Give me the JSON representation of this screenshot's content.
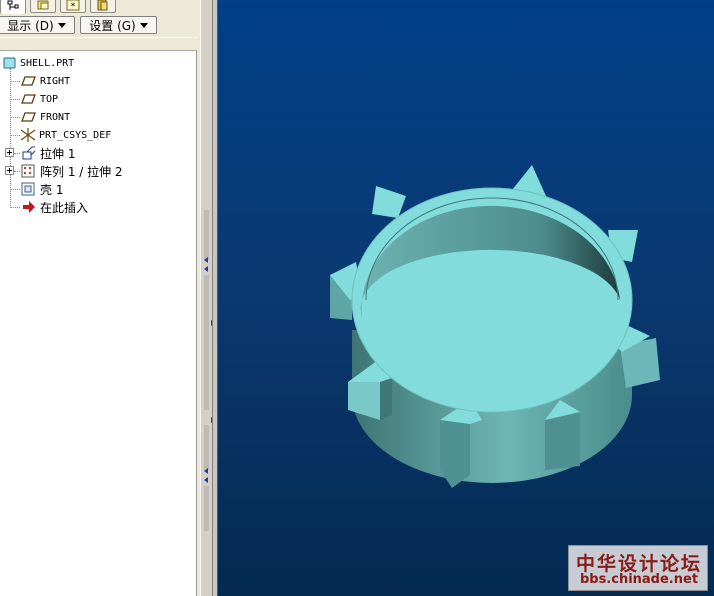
{
  "panel_tabs": [
    {
      "icon": "model-tree-tab-icon",
      "active": true
    },
    {
      "icon": "folder-browser-tab-icon",
      "active": false
    },
    {
      "icon": "favorites-tab-icon",
      "active": false
    },
    {
      "icon": "layers-tab-icon",
      "active": false
    }
  ],
  "menus": {
    "show_label": "显示 (D)",
    "settings_label": "设置 (G)"
  },
  "tree": {
    "root": {
      "label": "SHELL.PRT",
      "icon": "part-icon"
    },
    "items": [
      {
        "label": "RIGHT",
        "icon": "datum-plane-icon"
      },
      {
        "label": "TOP",
        "icon": "datum-plane-icon"
      },
      {
        "label": "FRONT",
        "icon": "datum-plane-icon"
      },
      {
        "label": "PRT_CSYS_DEF",
        "icon": "coordinate-system-icon"
      },
      {
        "label": "拉伸 1",
        "icon": "extrude-icon",
        "expandable": true
      },
      {
        "label": "阵列 1 / 拉伸 2",
        "icon": "pattern-icon",
        "expandable": true
      },
      {
        "label": "壳 1",
        "icon": "shell-icon"
      },
      {
        "label": "在此插入",
        "icon": "insert-here-arrow-icon"
      }
    ]
  },
  "watermark": {
    "title": "中华设计论坛",
    "url": "bbs.chinade.net"
  },
  "colors": {
    "viewport_top": "#003f89",
    "viewport_bottom": "#042a52",
    "model_face": "#82dcdc",
    "model_side": "#5aa3a3",
    "model_dark": "#2b5c5e",
    "watermark_text": "#8b1b17"
  }
}
